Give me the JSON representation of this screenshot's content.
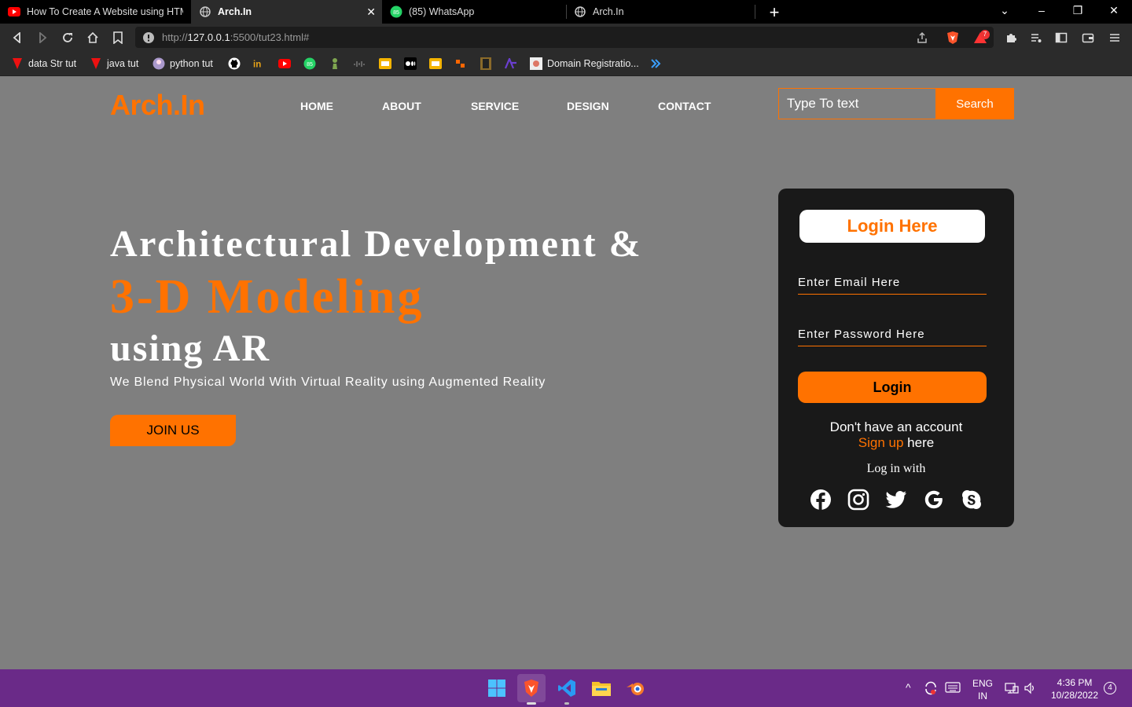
{
  "browser": {
    "tabs": [
      {
        "title": "How To Create A Website using HTML",
        "icon": "youtube-icon",
        "active": false
      },
      {
        "title": "Arch.In",
        "icon": "globe-icon",
        "active": true
      },
      {
        "title": "(85) WhatsApp",
        "icon": "whatsapp-icon",
        "active": false
      },
      {
        "title": "Arch.In",
        "icon": "globe-icon",
        "active": false
      }
    ],
    "url_scheme": "http://",
    "url_host": "127.0.0.1",
    "url_rest": ":5500/tut23.html#",
    "notification_count": "7",
    "bookmarks": [
      {
        "label": "data Str tut",
        "icon": "brave-icon"
      },
      {
        "label": "java tut",
        "icon": "brave-icon"
      },
      {
        "label": "python tut",
        "icon": "avatar-icon"
      },
      {
        "label": "Domain Registratio...",
        "icon": "domain-icon"
      }
    ]
  },
  "site": {
    "logo": "Arch.In",
    "nav": [
      "HOME",
      "ABOUT",
      "SERVICE",
      "DESIGN",
      "CONTACT"
    ],
    "search_placeholder": "Type To text",
    "search_button": "Search",
    "hero": {
      "line1": "Architectural Development &",
      "line2": "3-D Modeling",
      "line3": "using AR",
      "subtitle": "We Blend Physical World With Virtual Reality using Augmented Reality",
      "join_button": "JOIN US"
    },
    "login": {
      "title": "Login Here",
      "email_placeholder": "Enter Email Here",
      "password_placeholder": "Enter Password Here",
      "button": "Login",
      "no_account": "Don't have an account",
      "signup_link": "Sign up",
      "signup_suffix": " here",
      "login_with": "Log in with",
      "socials": [
        "facebook-icon",
        "instagram-icon",
        "twitter-icon",
        "google-icon",
        "skype-icon"
      ]
    },
    "colors": {
      "accent": "#ff7200",
      "page_bg": "#7f7f7f",
      "card_bg": "#1c1c1c"
    }
  },
  "taskbar": {
    "lang_top": "ENG",
    "lang_bottom": "IN",
    "time": "4:36 PM",
    "date": "10/28/2022",
    "notifications": "4"
  }
}
